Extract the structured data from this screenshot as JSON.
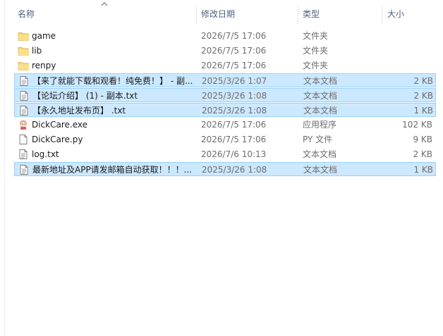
{
  "columns": {
    "name": "名称",
    "date": "修改日期",
    "type": "类型",
    "size": "大小"
  },
  "rows": [
    {
      "name": "game",
      "date": "2026/7/5 17:06",
      "type": "文件夹",
      "size": "",
      "icon": "folder-icon",
      "selected": false
    },
    {
      "name": "lib",
      "date": "2026/7/5 17:06",
      "type": "文件夹",
      "size": "",
      "icon": "folder-icon",
      "selected": false
    },
    {
      "name": "renpy",
      "date": "2026/7/5 17:06",
      "type": "文件夹",
      "size": "",
      "icon": "folder-icon",
      "selected": false
    },
    {
      "name": "【来了就能下载和观看！纯免费！】 - 副...",
      "date": "2025/3/26 1:07",
      "type": "文本文档",
      "size": "2 KB",
      "icon": "text-file-icon",
      "selected": true
    },
    {
      "name": "【论坛介绍】 (1) - 副本.txt",
      "date": "2025/3/26 1:08",
      "type": "文本文档",
      "size": "2 KB",
      "icon": "text-file-icon",
      "selected": true
    },
    {
      "name": "【永久地址发布页】 .txt",
      "date": "2025/3/26 1:08",
      "type": "文本文档",
      "size": "1 KB",
      "icon": "text-file-icon",
      "selected": true
    },
    {
      "name": "DickCare.exe",
      "date": "2026/7/5 17:06",
      "type": "应用程序",
      "size": "102 KB",
      "icon": "app-icon",
      "selected": false
    },
    {
      "name": "DickCare.py",
      "date": "2026/7/5 17:06",
      "type": "PY 文件",
      "size": "9 KB",
      "icon": "blank-file-icon",
      "selected": false
    },
    {
      "name": "log.txt",
      "date": "2026/7/6 10:13",
      "type": "文本文档",
      "size": "2 KB",
      "icon": "text-file-icon",
      "selected": false
    },
    {
      "name": "最新地址及APP请发邮箱自动获取！！！...",
      "date": "2025/3/26 1:08",
      "type": "文本文档",
      "size": "1 KB",
      "icon": "text-file-icon",
      "selected": true
    }
  ],
  "colors": {
    "selection": "#cce8ff",
    "selection_border": "#99d1ff",
    "folder": "#f8d775",
    "header_text": "#4d6080"
  }
}
